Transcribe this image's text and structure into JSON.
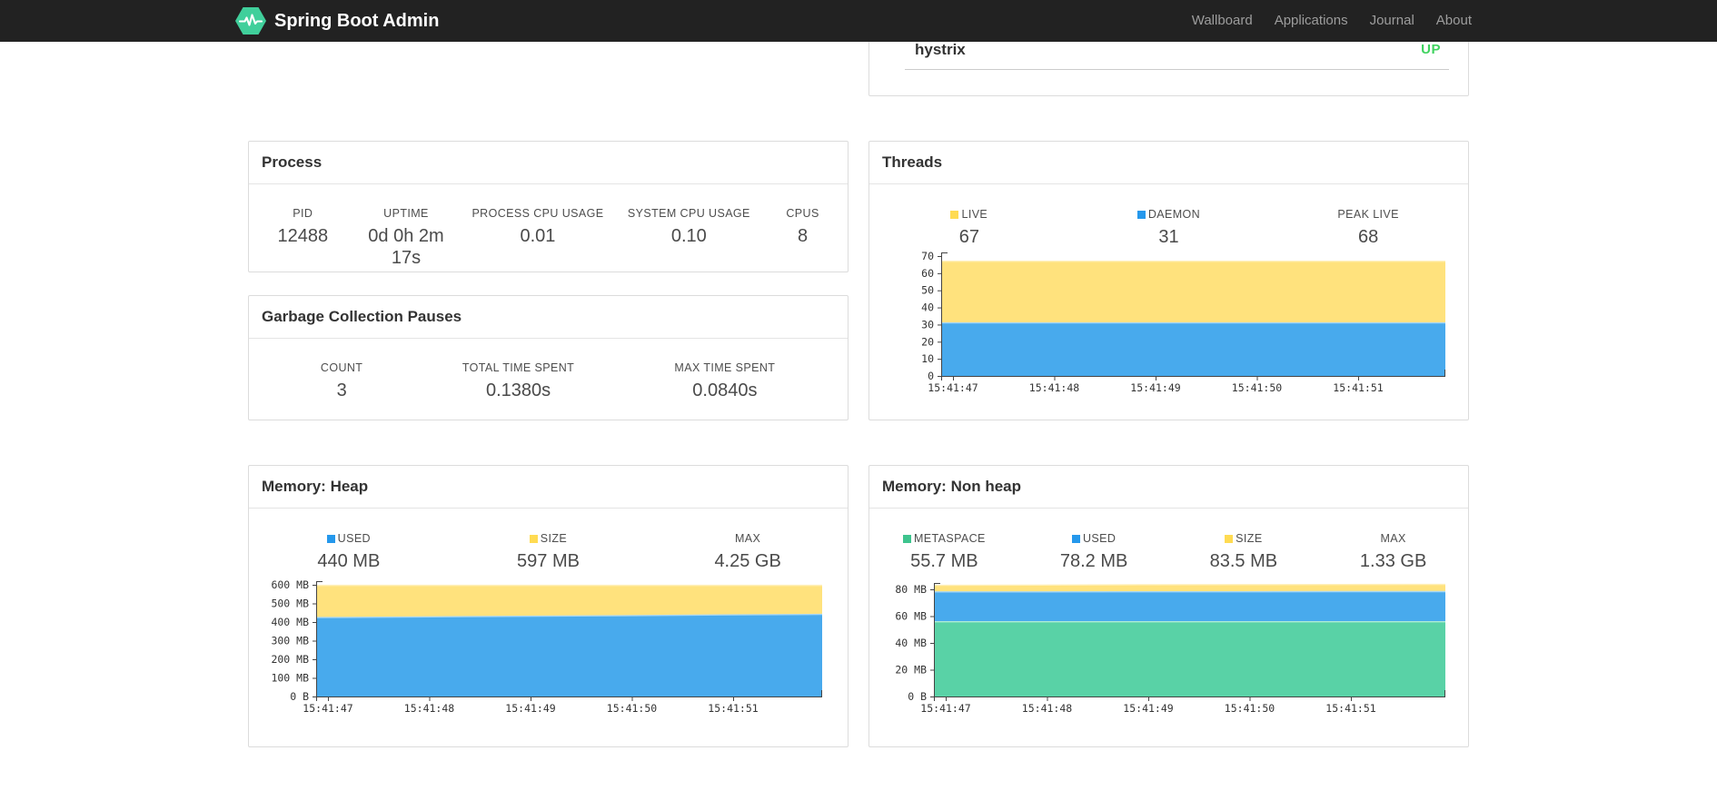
{
  "colors": {
    "navbar_bg": "#222222",
    "brand_green": "#40CF9B",
    "status_up_green": "#3FD35F",
    "legend_yellow": "#FFDB52",
    "legend_blue": "#2598EC",
    "legend_green": "#3EC48E",
    "area_yellow": "#FFE27D",
    "area_blue": "#48AAED",
    "area_green": "#59D2A6"
  },
  "navbar": {
    "brand": "Spring Boot Admin",
    "items": [
      {
        "label": "Wallboard"
      },
      {
        "label": "Applications"
      },
      {
        "label": "Journal"
      },
      {
        "label": "About"
      }
    ]
  },
  "application_card": {
    "name": "hystrix",
    "status": "UP"
  },
  "process": {
    "title": "Process",
    "metrics": [
      {
        "label": "PID",
        "value": "12488"
      },
      {
        "label": "UPTIME",
        "value": "0d 0h 2m 17s"
      },
      {
        "label": "PROCESS CPU USAGE",
        "value": "0.01"
      },
      {
        "label": "SYSTEM CPU USAGE",
        "value": "0.10"
      },
      {
        "label": "CPUS",
        "value": "8"
      }
    ]
  },
  "gc": {
    "title": "Garbage Collection Pauses",
    "metrics": [
      {
        "label": "COUNT",
        "value": "3"
      },
      {
        "label": "TOTAL TIME SPENT",
        "value": "0.1380s"
      },
      {
        "label": "MAX TIME SPENT",
        "value": "0.0840s"
      }
    ]
  },
  "threads": {
    "title": "Threads",
    "metrics": [
      {
        "label": "LIVE",
        "value": "67",
        "color": "#FFDB52"
      },
      {
        "label": "DAEMON",
        "value": "31",
        "color": "#2598EC"
      },
      {
        "label": "PEAK LIVE",
        "value": "68"
      }
    ],
    "chart_data": {
      "type": "area",
      "stacked": true,
      "x_labels": [
        "15:41:47",
        "15:41:48",
        "15:41:49",
        "15:41:50",
        "15:41:51"
      ],
      "y_max": 70,
      "y_ticks": [
        {
          "v": 0,
          "label": "0"
        },
        {
          "v": 10,
          "label": "10"
        },
        {
          "v": 20,
          "label": "20"
        },
        {
          "v": 30,
          "label": "30"
        },
        {
          "v": 40,
          "label": "40"
        },
        {
          "v": 50,
          "label": "50"
        },
        {
          "v": 60,
          "label": "60"
        },
        {
          "v": 70,
          "label": "70"
        }
      ],
      "series": [
        {
          "name": "daemon",
          "fill": "#48AAED",
          "edge": "#A6D7F5",
          "tops": [
            31,
            31,
            31,
            31,
            31,
            31
          ]
        },
        {
          "name": "live",
          "fill": "#FFE27D",
          "edge": "#FFF0BA",
          "tops": [
            67,
            67,
            67,
            67,
            67,
            67
          ]
        }
      ]
    }
  },
  "memory_heap": {
    "title": "Memory: Heap",
    "metrics": [
      {
        "label": "USED",
        "value": "440 MB",
        "color": "#2598EC"
      },
      {
        "label": "SIZE",
        "value": "597 MB",
        "color": "#FFDB52"
      },
      {
        "label": "MAX",
        "value": "4.25 GB"
      }
    ],
    "chart_data": {
      "type": "area",
      "stacked": true,
      "x_labels": [
        "15:41:47",
        "15:41:48",
        "15:41:49",
        "15:41:50",
        "15:41:51"
      ],
      "y_max": 600,
      "y_ticks": [
        {
          "v": 0,
          "label": "0 B"
        },
        {
          "v": 100,
          "label": "100 MB"
        },
        {
          "v": 200,
          "label": "200 MB"
        },
        {
          "v": 300,
          "label": "300 MB"
        },
        {
          "v": 400,
          "label": "400 MB"
        },
        {
          "v": 500,
          "label": "500 MB"
        },
        {
          "v": 600,
          "label": "600 MB"
        }
      ],
      "series": [
        {
          "name": "used",
          "fill": "#48AAED",
          "edge": "#A6D7F5",
          "tops": [
            424,
            427,
            431,
            434,
            438,
            441
          ]
        },
        {
          "name": "size",
          "fill": "#FFE27D",
          "edge": "#FFF0BA",
          "tops": [
            597,
            597,
            597,
            597,
            597,
            597
          ]
        }
      ]
    }
  },
  "memory_non_heap": {
    "title": "Memory: Non heap",
    "metrics": [
      {
        "label": "METASPACE",
        "value": "55.7 MB",
        "color": "#3EC48E"
      },
      {
        "label": "USED",
        "value": "78.2 MB",
        "color": "#2598EC"
      },
      {
        "label": "SIZE",
        "value": "83.5 MB",
        "color": "#FFDB52"
      },
      {
        "label": "MAX",
        "value": "1.33 GB"
      }
    ],
    "chart_data": {
      "type": "area",
      "stacked": true,
      "x_labels": [
        "15:41:47",
        "15:41:48",
        "15:41:49",
        "15:41:50",
        "15:41:51"
      ],
      "y_max": 80,
      "y_ticks": [
        {
          "v": 0,
          "label": "0 B"
        },
        {
          "v": 20,
          "label": "20 MB"
        },
        {
          "v": 40,
          "label": "40 MB"
        },
        {
          "v": 60,
          "label": "60 MB"
        },
        {
          "v": 80,
          "label": "80 MB"
        }
      ],
      "series": [
        {
          "name": "metaspace",
          "fill": "#59D2A6",
          "edge": "#AEEBD6",
          "tops": [
            55.8,
            55.8,
            55.8,
            55.8,
            55.8,
            55.8
          ]
        },
        {
          "name": "used",
          "fill": "#48AAED",
          "edge": "#A6D7F5",
          "tops": [
            78.1,
            78.1,
            78.2,
            78.2,
            78.3,
            78.3
          ]
        },
        {
          "name": "size",
          "fill": "#FFE27D",
          "edge": "#FFF0BA",
          "tops": [
            83.0,
            83.2,
            83.4,
            83.5,
            83.6,
            83.7
          ]
        }
      ]
    }
  }
}
